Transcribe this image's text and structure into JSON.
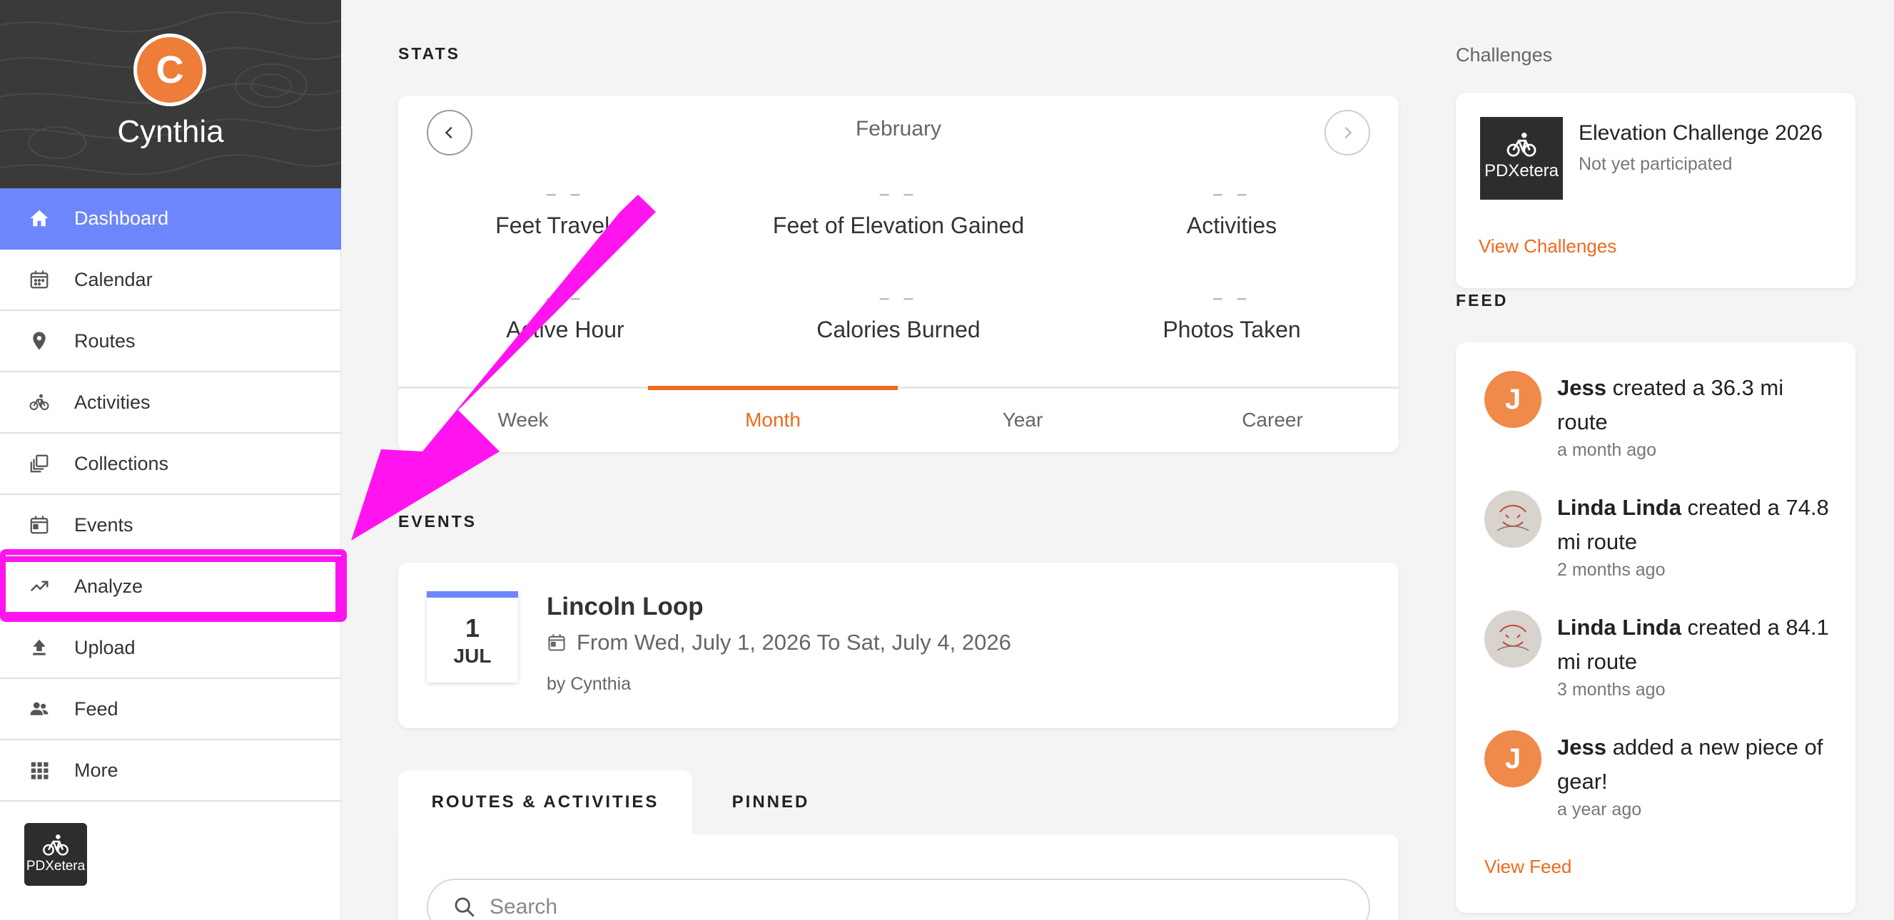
{
  "sidebar": {
    "user": {
      "initial": "C",
      "name": "Cynthia"
    },
    "items": [
      {
        "label": "Dashboard",
        "icon": "home-icon"
      },
      {
        "label": "Calendar",
        "icon": "calendar-icon"
      },
      {
        "label": "Routes",
        "icon": "pin-icon"
      },
      {
        "label": "Activities",
        "icon": "bike-icon"
      },
      {
        "label": "Collections",
        "icon": "collections-icon"
      },
      {
        "label": "Events",
        "icon": "event-icon"
      },
      {
        "label": "Analyze",
        "icon": "trend-icon"
      },
      {
        "label": "Upload",
        "icon": "upload-icon"
      },
      {
        "label": "Feed",
        "icon": "people-icon"
      },
      {
        "label": "More",
        "icon": "grid-icon"
      }
    ],
    "active_item": "Dashboard",
    "highlighted_item": "Analyze",
    "brand": "PDXetera"
  },
  "stats": {
    "title": "STATS",
    "month": "February",
    "items": [
      {
        "value": "– –",
        "label": "Feet Traveled"
      },
      {
        "value": "– –",
        "label": "Feet of Elevation Gained"
      },
      {
        "value": "– –",
        "label": "Activities"
      },
      {
        "value": "– –",
        "label": "Active Hour"
      },
      {
        "value": "– –",
        "label": "Calories Burned"
      },
      {
        "value": "– –",
        "label": "Photos Taken"
      }
    ],
    "tabs": [
      "Week",
      "Month",
      "Year",
      "Career"
    ],
    "active_tab": "Month"
  },
  "events": {
    "title": "EVENTS",
    "items": [
      {
        "day": "1",
        "month": "JUL",
        "name": "Lincoln Loop",
        "dates": "From Wed, July 1, 2026 To Sat, July 4, 2026",
        "by": "by Cynthia"
      }
    ]
  },
  "bottom_tabs": {
    "tabs": [
      "ROUTES & ACTIVITIES",
      "PINNED"
    ],
    "active": "ROUTES & ACTIVITIES",
    "search_placeholder": "Search"
  },
  "challenges": {
    "title": "Challenges",
    "item": {
      "logo": "PDXetera",
      "name": "Elevation Challenge 2026",
      "status": "Not yet participated"
    },
    "link": "View Challenges"
  },
  "feed": {
    "title": "FEED",
    "items": [
      {
        "avatar": "J",
        "user": "Jess",
        "action": " created a 36.3 mi route",
        "time": "a month ago"
      },
      {
        "avatar": "",
        "user": "Linda Linda",
        "action": " created a 74.8 mi route",
        "time": "2 months ago"
      },
      {
        "avatar": "",
        "user": "Linda Linda",
        "action": " created a 84.1 mi route",
        "time": "3 months ago"
      },
      {
        "avatar": "J",
        "user": "Jess",
        "action": " added a new piece of gear!",
        "time": "a year ago"
      }
    ],
    "link": "View Feed"
  },
  "colors": {
    "accent": "#ee6a1c",
    "active_nav": "#6d86fb",
    "annotation": "#ff14f0",
    "avatar_orange": "#ef7d3a"
  }
}
